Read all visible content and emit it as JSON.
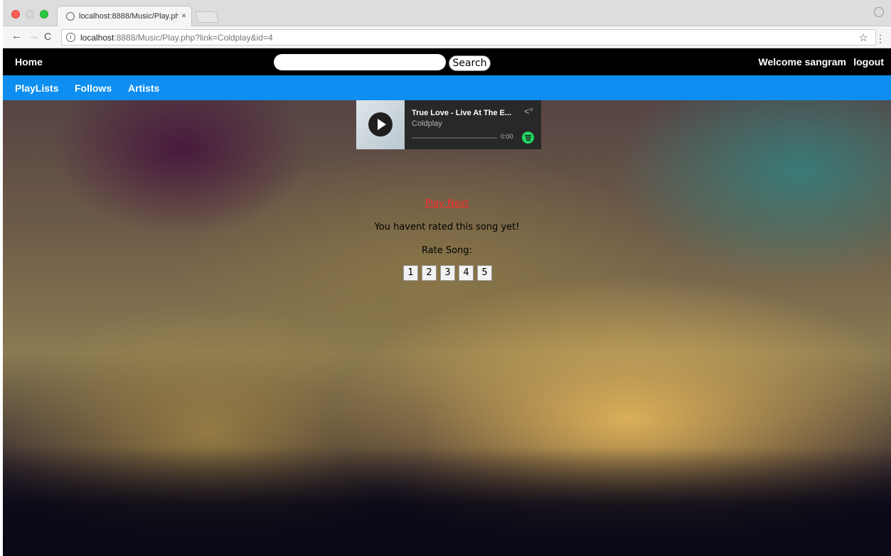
{
  "browser": {
    "tab_title": "localhost:8888/Music/Play.php",
    "tab_close": "×",
    "url_host": "localhost",
    "url_rest": ":8888/Music/Play.php?link=Coldplay&id=4"
  },
  "topnav": {
    "home": "Home",
    "search_value": "",
    "search_button": "Search",
    "welcome": "Welcome sangram",
    "logout": "logout"
  },
  "subnav": {
    "items": [
      {
        "label": "PlayLists"
      },
      {
        "label": "Follows"
      },
      {
        "label": "Artists"
      }
    ]
  },
  "player": {
    "track": "True Love - Live At The E...",
    "artist": "Coldplay",
    "time": "0:00"
  },
  "rating": {
    "play_next": "Play Next",
    "message": "You havent rated this song yet!",
    "label": "Rate Song:",
    "options": [
      "1",
      "2",
      "3",
      "4",
      "5"
    ]
  },
  "colors": {
    "topnav_bg": "#000000",
    "subnav_bg": "#0d8ef0",
    "play_next": "#ff2a2a",
    "spotify_green": "#1ed760"
  }
}
